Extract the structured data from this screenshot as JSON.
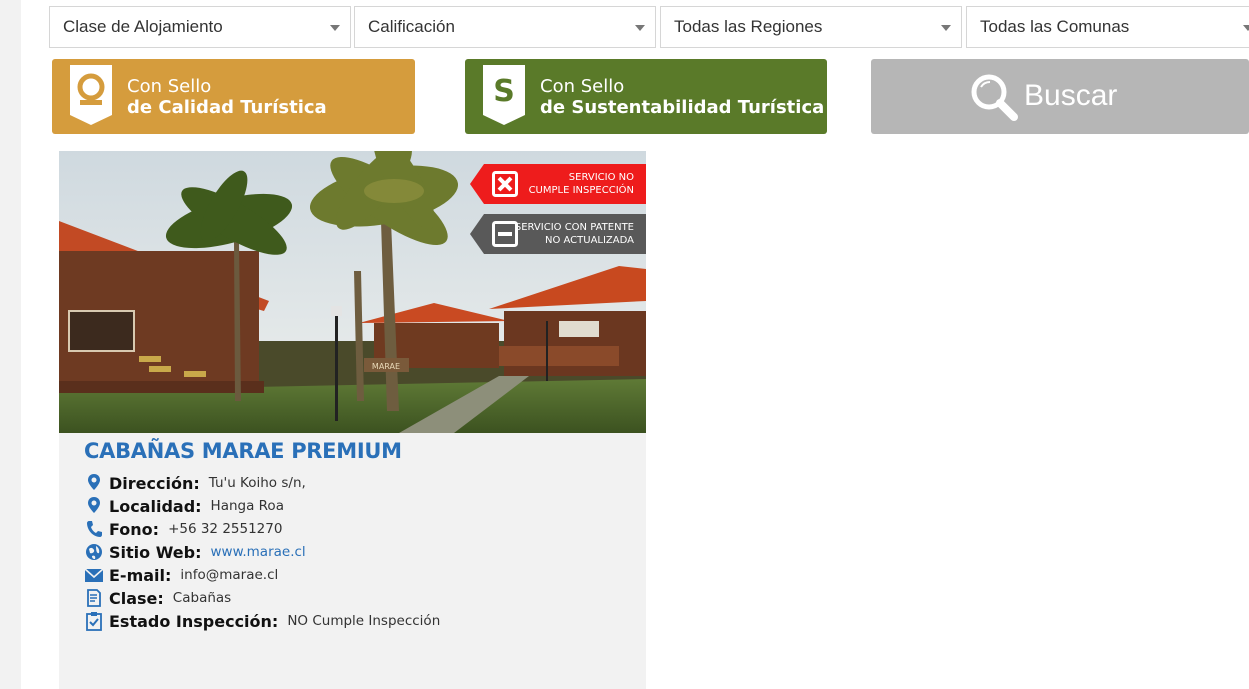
{
  "filters": {
    "type": "Clase de Alojamiento",
    "rating": "Calificación",
    "region": "Todas las Regiones",
    "commune": "Todas las Comunas"
  },
  "seals": {
    "quality": {
      "line1": "Con Sello",
      "line2": "de Calidad Turística",
      "color": "#d59c3d"
    },
    "sustainability": {
      "line1": "Con Sello",
      "line2": "de Sustentabilidad Turística",
      "color": "#5a7a29"
    }
  },
  "search": {
    "label": "Buscar",
    "color": "#b6b6b6"
  },
  "listing": {
    "name": "CABAÑAS MARAE PREMIUM",
    "flags": [
      {
        "line1": "SERVICIO NO",
        "line2": "CUMPLE INSPECCIÓN",
        "color": "#ee1c1c",
        "icon": "x-box-icon"
      },
      {
        "line1": "SERVICIO CON PATENTE",
        "line2": "NO ACTUALIZADA",
        "color": "#595959",
        "icon": "minus-box-icon"
      }
    ],
    "sign_text": "MARAE",
    "details": [
      {
        "label": "Dirección:",
        "value": "Tu'u Koiho s/n,",
        "icon": "location-pin-icon"
      },
      {
        "label": "Localidad:",
        "value": "Hanga Roa",
        "icon": "location-pin-icon"
      },
      {
        "label": "Fono:",
        "value": "+56 32 2551270",
        "icon": "phone-icon"
      },
      {
        "label": "Sitio Web:",
        "value": "www.marae.cl",
        "icon": "globe-icon"
      },
      {
        "label": "E-mail:",
        "value": "info@marae.cl",
        "icon": "envelope-icon"
      },
      {
        "label": "Clase:",
        "value": "Cabañas",
        "icon": "document-icon"
      },
      {
        "label": "Estado Inspección:",
        "value": "NO Cumple Inspección",
        "icon": "clipboard-check-icon"
      }
    ]
  }
}
